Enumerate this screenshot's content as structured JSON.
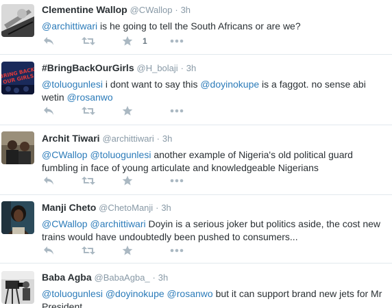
{
  "tweets": [
    {
      "name": "Clementine Wallop",
      "handle": "@CWallop",
      "time": "3h",
      "avatar_icon": "grayscale-sketch-avatar",
      "text_parts": [
        {
          "type": "mention",
          "text": "@archittiwari"
        },
        {
          "type": "text",
          "text": " is he going to tell the South Africans or are we?"
        }
      ],
      "favorite_count": "1"
    },
    {
      "name": "#BringBackOurGirls",
      "handle": "@H_bolaji",
      "time": "3h",
      "avatar_icon": "bring-back-our-girls-avatar",
      "avatar_text": "BRING BACK OUR GIRLS",
      "text_parts": [
        {
          "type": "mention",
          "text": "@toluogunlesi"
        },
        {
          "type": "text",
          "text": " i dont want to say this "
        },
        {
          "type": "mention",
          "text": "@doyinokupe"
        },
        {
          "type": "text",
          "text": " is a faggot. no sense abi wetin "
        },
        {
          "type": "mention",
          "text": "@rosanwo"
        }
      ],
      "favorite_count": ""
    },
    {
      "name": "Archit Tiwari",
      "handle": "@archittiwari",
      "time": "3h",
      "avatar_icon": "people-photo-avatar",
      "text_parts": [
        {
          "type": "mention",
          "text": "@CWallop"
        },
        {
          "type": "text",
          "text": " "
        },
        {
          "type": "mention",
          "text": "@toluogunlesi"
        },
        {
          "type": "text",
          "text": " another example of Nigeria's old political guard fumbling in face  of young articulate and knowledgeable Nigerians"
        }
      ],
      "favorite_count": ""
    },
    {
      "name": "Manji Cheto",
      "handle": "@ChetoManji",
      "time": "3h",
      "avatar_icon": "portrait-photo-avatar",
      "text_parts": [
        {
          "type": "mention",
          "text": "@CWallop"
        },
        {
          "type": "text",
          "text": " "
        },
        {
          "type": "mention",
          "text": "@archittiwari"
        },
        {
          "type": "text",
          "text": " Doyin is a serious joker but politics aside, the cost new trains would have undoubtedly been pushed to consumers..."
        }
      ],
      "favorite_count": ""
    },
    {
      "name": "Baba Agba",
      "handle": "@BabaAgba_",
      "time": "3h",
      "avatar_icon": "camera-operator-avatar",
      "text_parts": [
        {
          "type": "mention",
          "text": "@toluogunlesi"
        },
        {
          "type": "text",
          "text": " "
        },
        {
          "type": "mention",
          "text": "@doyinokupe"
        },
        {
          "type": "text",
          "text": " "
        },
        {
          "type": "mention",
          "text": "@rosanwo"
        },
        {
          "type": "text",
          "text": " but it can support brand new jets for Mr President"
        }
      ],
      "favorite_count": ""
    }
  ],
  "separator": "·",
  "action_icons": [
    "reply-icon",
    "retweet-icon",
    "favorite-star-icon",
    "more-dots-icon"
  ],
  "colors": {
    "mention": "#2b7bb9",
    "text": "#292f33",
    "meta": "#8899a6",
    "action": "#aab8c2",
    "divider": "#e1e8ed"
  }
}
